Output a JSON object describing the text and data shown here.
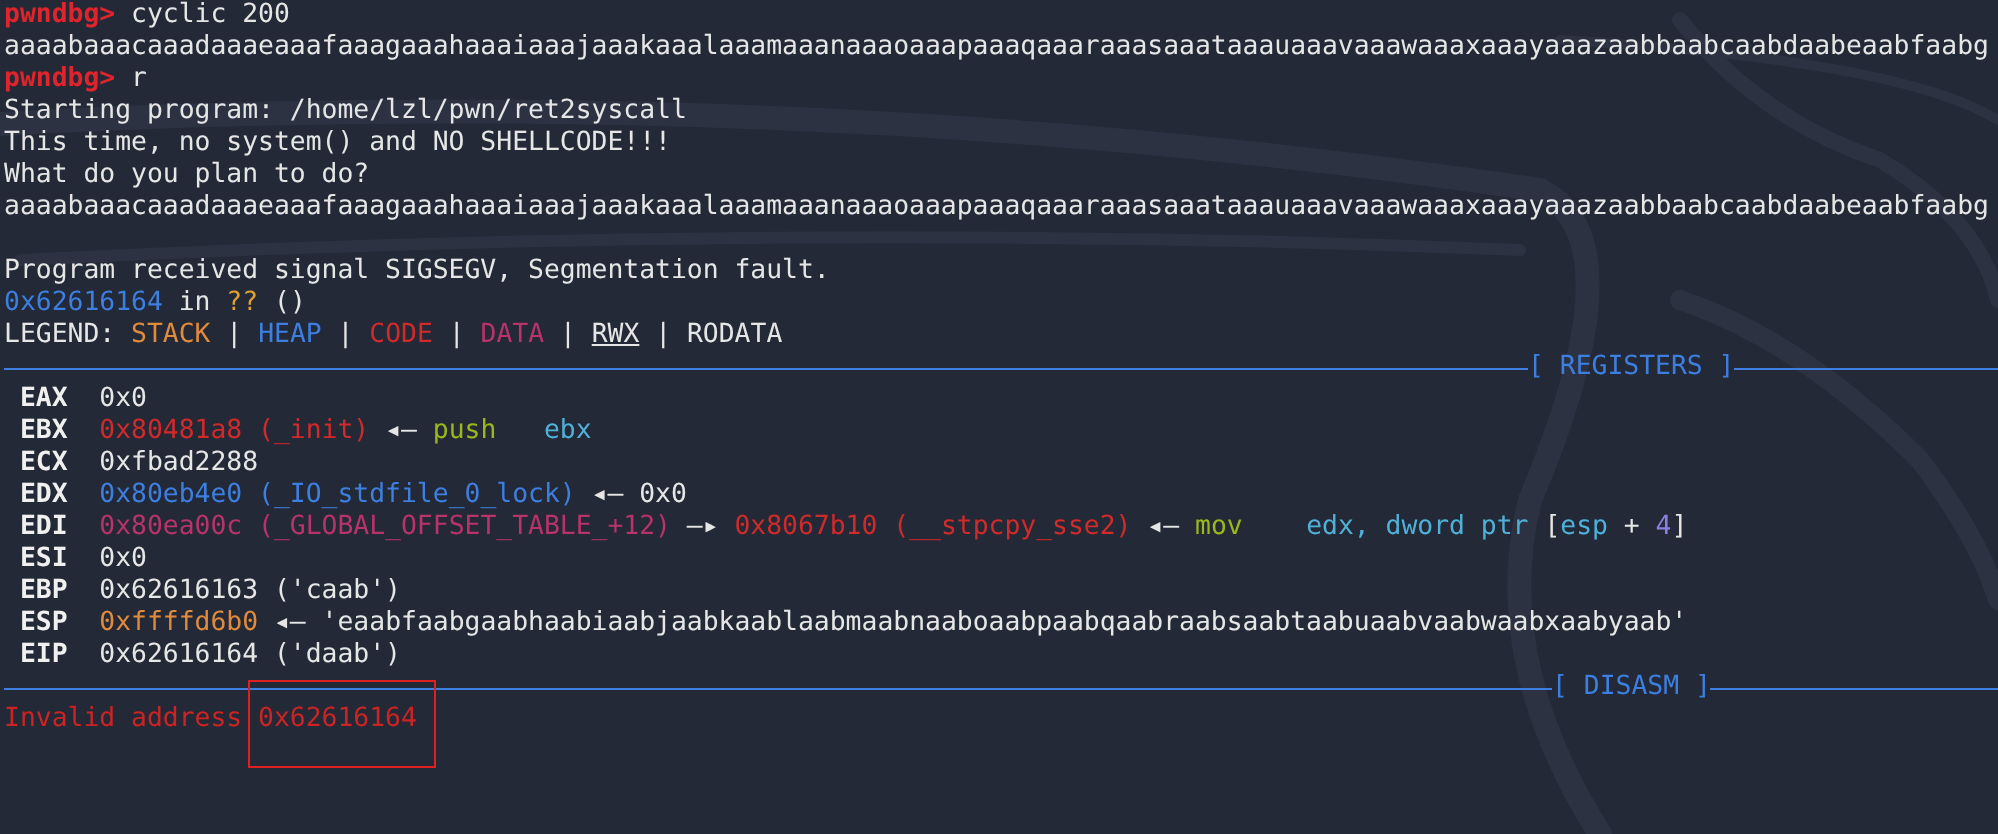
{
  "lines": [
    {
      "kind": "text",
      "segments": [
        {
          "kind": "prompt",
          "text": "pwndbg>"
        },
        {
          "kind": "plain",
          "text": " cyclic 200"
        }
      ]
    },
    {
      "kind": "text",
      "segments": [
        {
          "kind": "plain",
          "text": "aaaabaaacaaadaaaeaaafaaagaaahaaaiaaajaaakaaalaaamaaanaaaoaaapaaaqaaaraaasaaataaauaaavaaawaaaxaaayaaazaabbaabcaabdaabeaabfaabg"
        }
      ]
    },
    {
      "kind": "text",
      "segments": [
        {
          "kind": "prompt",
          "text": "pwndbg>"
        },
        {
          "kind": "plain",
          "text": " r"
        }
      ]
    },
    {
      "kind": "text",
      "segments": [
        {
          "kind": "plain",
          "text": "Starting program: /home/lzl/pwn/ret2syscall"
        }
      ]
    },
    {
      "kind": "text",
      "segments": [
        {
          "kind": "plain",
          "text": "This time, no system() and NO SHELLCODE!!!"
        }
      ]
    },
    {
      "kind": "text",
      "segments": [
        {
          "kind": "plain",
          "text": "What do you plan to do?"
        }
      ]
    },
    {
      "kind": "text",
      "segments": [
        {
          "kind": "plain",
          "text": "aaaabaaacaaadaaaeaaafaaagaaahaaaiaaajaaakaaalaaamaaanaaaoaaapaaaqaaaraaasaaataaauaaavaaawaaaxaaayaaazaabbaabcaabdaabeaabfaabg"
        }
      ]
    },
    {
      "kind": "blank"
    },
    {
      "kind": "text",
      "segments": [
        {
          "kind": "plain",
          "text": "Program received signal SIGSEGV, Segmentation fault."
        }
      ]
    },
    {
      "kind": "text",
      "segments": [
        {
          "kind": "heap",
          "text": "0x62616164"
        },
        {
          "kind": "plain",
          "text": " in "
        },
        {
          "kind": "unknown",
          "text": "??"
        },
        {
          "kind": "plain",
          "text": " ()"
        }
      ]
    },
    {
      "kind": "text",
      "segments": [
        {
          "kind": "plain",
          "text": "LEGEND: "
        },
        {
          "kind": "stack",
          "text": "STACK"
        },
        {
          "kind": "plain",
          "text": " | "
        },
        {
          "kind": "heap",
          "text": "HEAP"
        },
        {
          "kind": "plain",
          "text": " | "
        },
        {
          "kind": "code",
          "text": "CODE"
        },
        {
          "kind": "plain",
          "text": " | "
        },
        {
          "kind": "data",
          "text": "DATA"
        },
        {
          "kind": "plain",
          "text": " | "
        },
        {
          "kind": "rwx",
          "text": "RWX"
        },
        {
          "kind": "plain",
          "text": " | RODATA"
        }
      ]
    },
    {
      "kind": "rule",
      "label": "[ REGISTERS ]"
    },
    {
      "kind": "text",
      "segments": [
        {
          "kind": "regname",
          "text": " EAX "
        },
        {
          "kind": "plain",
          "text": " 0x0"
        }
      ]
    },
    {
      "kind": "text",
      "segments": [
        {
          "kind": "regname",
          "text": " EBX "
        },
        {
          "kind": "code",
          "text": " 0x80481a8 (_init)"
        },
        {
          "kind": "plain",
          "text": " ◂— "
        },
        {
          "kind": "instr",
          "text": "push"
        },
        {
          "kind": "reg",
          "text": "   ebx"
        }
      ]
    },
    {
      "kind": "text",
      "segments": [
        {
          "kind": "regname",
          "text": " ECX "
        },
        {
          "kind": "plain",
          "text": " 0xfbad2288"
        }
      ]
    },
    {
      "kind": "text",
      "segments": [
        {
          "kind": "regname",
          "text": " EDX "
        },
        {
          "kind": "heap",
          "text": " 0x80eb4e0 (_IO_stdfile_0_lock)"
        },
        {
          "kind": "plain",
          "text": " ◂— 0x0"
        }
      ]
    },
    {
      "kind": "text",
      "segments": [
        {
          "kind": "regname",
          "text": " EDI "
        },
        {
          "kind": "data",
          "text": " 0x80ea00c (_GLOBAL_OFFSET_TABLE_+12)"
        },
        {
          "kind": "plain",
          "text": " —▸ "
        },
        {
          "kind": "code",
          "text": "0x8067b10 (__stpcpy_sse2)"
        },
        {
          "kind": "plain",
          "text": " ◂— "
        },
        {
          "kind": "instr",
          "text": "mov"
        },
        {
          "kind": "reg",
          "text": "    edx, dword ptr "
        },
        {
          "kind": "plain",
          "text": "["
        },
        {
          "kind": "reg",
          "text": "esp"
        },
        {
          "kind": "plain",
          "text": " + "
        },
        {
          "kind": "num",
          "text": "4"
        },
        {
          "kind": "plain",
          "text": "]"
        }
      ]
    },
    {
      "kind": "text",
      "segments": [
        {
          "kind": "regname",
          "text": " ESI "
        },
        {
          "kind": "plain",
          "text": " 0x0"
        }
      ]
    },
    {
      "kind": "text",
      "segments": [
        {
          "kind": "regname",
          "text": " EBP "
        },
        {
          "kind": "plain",
          "text": " 0x62616163 ('caab')"
        }
      ]
    },
    {
      "kind": "text",
      "segments": [
        {
          "kind": "regname",
          "text": " ESP "
        },
        {
          "kind": "stack",
          "text": " 0xffffd6b0"
        },
        {
          "kind": "plain",
          "text": " ◂— 'eaabfaabgaabhaabiaabjaabkaablaabmaabnaaboaabpaabqaabraabsaabtaabuaabvaabwaabxaabyaab'"
        }
      ]
    },
    {
      "kind": "text",
      "segments": [
        {
          "kind": "regname",
          "text": " EIP "
        },
        {
          "kind": "plain",
          "text": " 0x62616164 ('daab')"
        }
      ]
    },
    {
      "kind": "rule",
      "label": "[ DISASM ]"
    },
    {
      "kind": "text",
      "segments": [
        {
          "kind": "invalid",
          "text": "Invalid address 0x62616164"
        }
      ]
    }
  ]
}
